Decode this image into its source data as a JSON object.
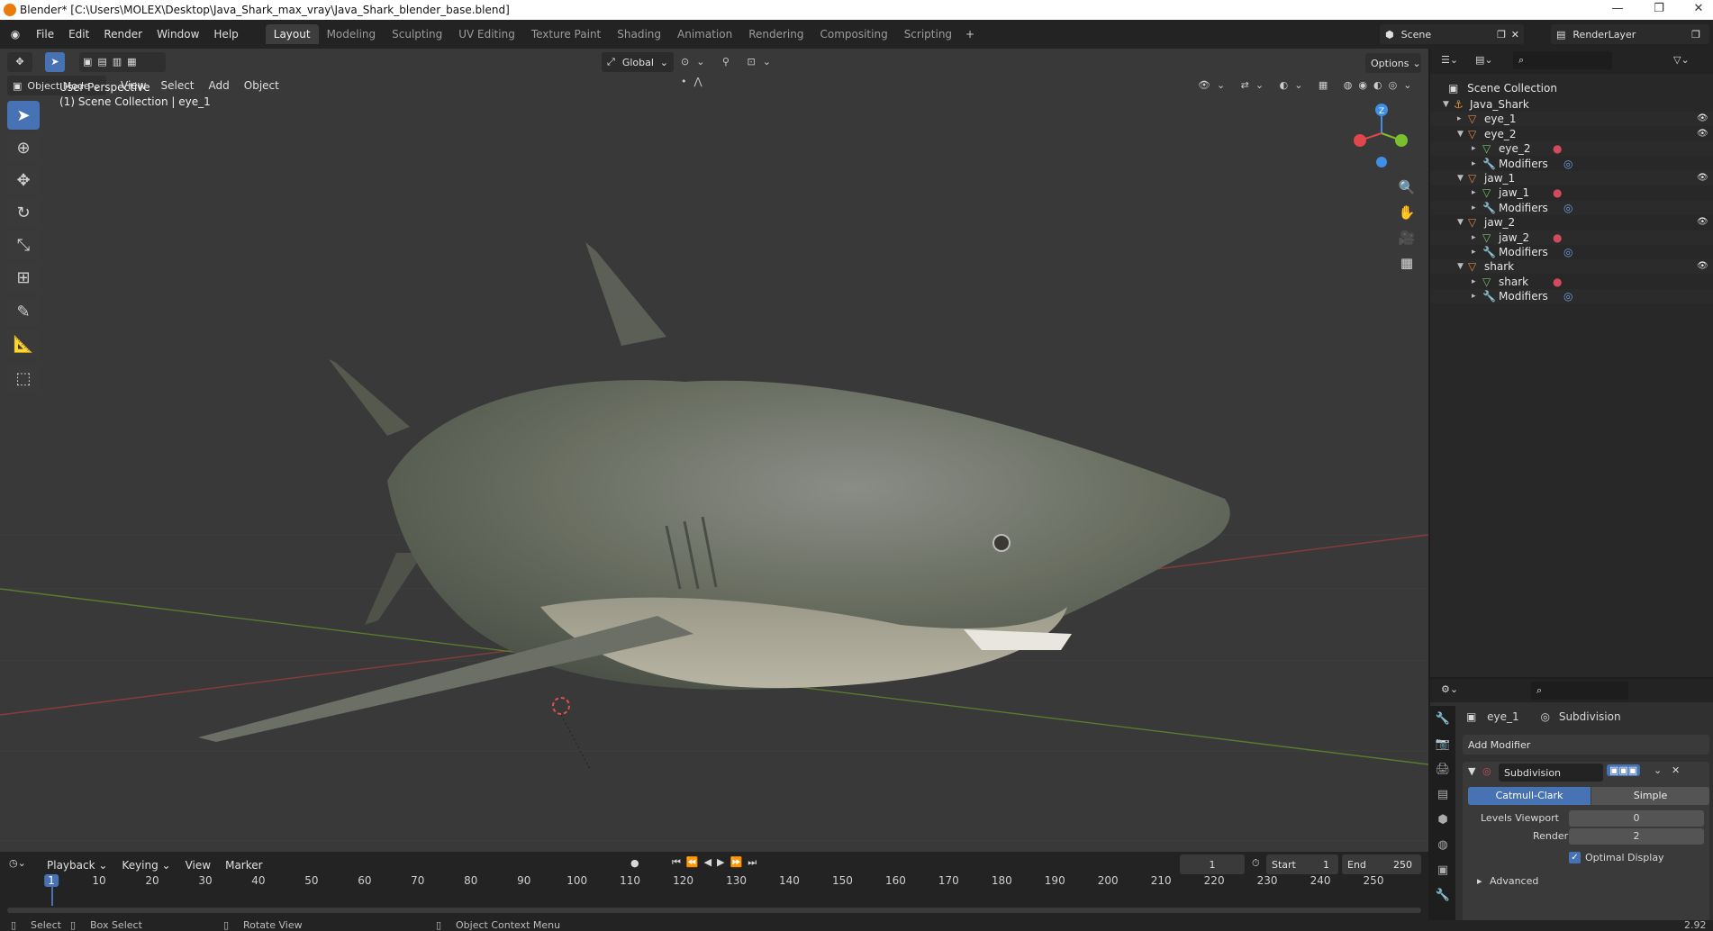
{
  "window": {
    "title": "Blender* [C:\\Users\\MOLEX\\Desktop\\Java_Shark_max_vray\\Java_Shark_blender_base.blend]",
    "minimize": "—",
    "maximize": "❐",
    "close": "✕"
  },
  "menu": [
    "File",
    "Edit",
    "Render",
    "Window",
    "Help"
  ],
  "workspaces": [
    "Layout",
    "Modeling",
    "Sculpting",
    "UV Editing",
    "Texture Paint",
    "Shading",
    "Animation",
    "Rendering",
    "Compositing",
    "Scripting"
  ],
  "active_workspace": "Layout",
  "scene": {
    "name": "Scene",
    "render_layer": "RenderLayer"
  },
  "viewport": {
    "orientation": "Global",
    "options_label": "Options",
    "mode": "Object Mode",
    "header_menus": [
      "View",
      "Select",
      "Add",
      "Object"
    ],
    "overlay_title": "User Perspective",
    "overlay_subtitle": "(1) Scene Collection | eye_1",
    "gizmo": {
      "z": "Z"
    }
  },
  "outliner": {
    "root": "Scene Collection",
    "rows": [
      {
        "label": "Java_Shark",
        "indent": 1,
        "icon": "empty",
        "arrow": "▼"
      },
      {
        "label": "eye_1",
        "indent": 2,
        "icon": "object",
        "arrow": "▸"
      },
      {
        "label": "eye_2",
        "indent": 2,
        "icon": "object",
        "arrow": "▼"
      },
      {
        "label": "eye_2",
        "indent": 3,
        "icon": "mesh",
        "arrow": "▸"
      },
      {
        "label": "Modifiers",
        "indent": 3,
        "icon": "wrench",
        "arrow": "▸"
      },
      {
        "label": "jaw_1",
        "indent": 2,
        "icon": "object",
        "arrow": "▼"
      },
      {
        "label": "jaw_1",
        "indent": 3,
        "icon": "mesh",
        "arrow": "▸"
      },
      {
        "label": "Modifiers",
        "indent": 3,
        "icon": "wrench",
        "arrow": "▸"
      },
      {
        "label": "jaw_2",
        "indent": 2,
        "icon": "object",
        "arrow": "▼"
      },
      {
        "label": "jaw_2",
        "indent": 3,
        "icon": "mesh",
        "arrow": "▸"
      },
      {
        "label": "Modifiers",
        "indent": 3,
        "icon": "wrench",
        "arrow": "▸"
      },
      {
        "label": "shark",
        "indent": 2,
        "icon": "object",
        "arrow": "▼"
      },
      {
        "label": "shark",
        "indent": 3,
        "icon": "mesh",
        "arrow": "▸"
      },
      {
        "label": "Modifiers",
        "indent": 3,
        "icon": "wrench",
        "arrow": "▸"
      }
    ]
  },
  "properties": {
    "object_name": "eye_1",
    "modifier_name": "Subdivision",
    "add_modifier": "Add Modifier",
    "modifier_field": "Subdivision",
    "algorithm_options": [
      "Catmull-Clark",
      "Simple"
    ],
    "selected_algorithm": "Catmull-Clark",
    "levels_viewport_label": "Levels Viewport",
    "levels_viewport": "0",
    "render_label": "Render",
    "render_value": "2",
    "optimal_display": "Optimal Display",
    "advanced": "Advanced"
  },
  "timeline": {
    "menus": [
      "Playback",
      "Keying",
      "View",
      "Marker"
    ],
    "current_frame": "1",
    "start_label": "Start",
    "start": "1",
    "end_label": "End",
    "end": "250",
    "ticks": [
      "1",
      "10",
      "20",
      "30",
      "40",
      "50",
      "60",
      "70",
      "80",
      "90",
      "100",
      "110",
      "120",
      "130",
      "140",
      "150",
      "160",
      "170",
      "180",
      "190",
      "200",
      "210",
      "220",
      "230",
      "240",
      "250"
    ]
  },
  "status": {
    "select": "Select",
    "box_select": "Box Select",
    "rotate_view": "Rotate View",
    "context_menu": "Object Context Menu",
    "version": "2.92"
  },
  "colors": {
    "accent": "#4772b3",
    "x_axis": "#e0474a",
    "y_axis": "#7cbf2e",
    "z_axis": "#3f8fe6",
    "object_orange": "#e08a3c",
    "mesh_green": "#6fc76f",
    "material_red": "#d14b5a"
  }
}
